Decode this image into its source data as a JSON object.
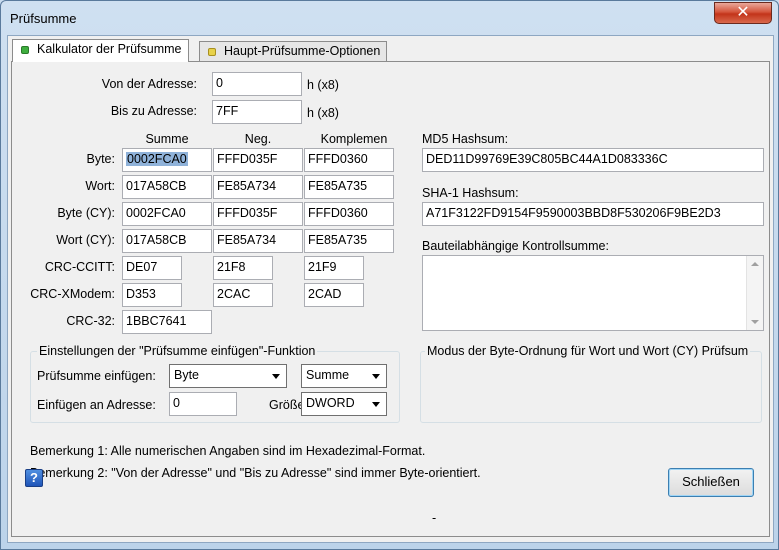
{
  "window": {
    "title": "Prüfsumme",
    "close_glyph": "✕"
  },
  "tabs": [
    {
      "label": "Kalkulator der Prüfsumme",
      "icon": "green-square-icon",
      "active": true
    },
    {
      "label": "Haupt-Prüfsumme-Optionen",
      "icon": "yellow-square-icon",
      "active": false
    }
  ],
  "range": {
    "from_label": "Von der Adresse:",
    "from_value": "0",
    "to_label": "Bis zu Adresse:",
    "to_value": "7FF",
    "unit": "h (x8)"
  },
  "checksums": {
    "columns": [
      "Summe",
      "Neg.",
      "Komplemen"
    ],
    "rows": [
      {
        "label": "Byte:",
        "values": [
          "0002FCA0",
          "FFFD035F",
          "FFFD0360"
        ]
      },
      {
        "label": "Wort:",
        "values": [
          "017A58CB",
          "FE85A734",
          "FE85A735"
        ]
      },
      {
        "label": "Byte (CY):",
        "values": [
          "0002FCA0",
          "FFFD035F",
          "FFFD0360"
        ]
      },
      {
        "label": "Wort (CY):",
        "values": [
          "017A58CB",
          "FE85A734",
          "FE85A735"
        ]
      },
      {
        "label": "CRC-CCITT:",
        "values": [
          "DE07",
          "21F8",
          "21F9"
        ]
      },
      {
        "label": "CRC-XModem:",
        "values": [
          "D353",
          "2CAC",
          "2CAD"
        ]
      },
      {
        "label": "CRC-32:",
        "values": [
          "1BBC7641"
        ]
      }
    ]
  },
  "hashes": {
    "md5_label": "MD5 Hashsum:",
    "md5_value": "DED11D99769E39C805BC44A1D083336C",
    "sha1_label": "SHA-1 Hashsum:",
    "sha1_value": "A71F3122FD9154F9590003BBD8F530206F9BE2D3",
    "device_label": "Bauteilabhängige Kontrollsumme:"
  },
  "insert_settings": {
    "legend": "Einstellungen der \"Prüfsumme einfügen\"-Funktion",
    "insert_label": "Prüfsumme einfügen:",
    "insert_type": "Byte",
    "insert_kind": "Summe",
    "address_label": "Einfügen an Adresse:",
    "address_value": "0",
    "size_label": "Größe:",
    "size_value": "DWORD"
  },
  "byte_order": {
    "legend": "Modus der Byte-Ordnung für Wort und Wort (CY) Prüfsum"
  },
  "notes": [
    "Bemerkung 1: Alle numerischen Angaben sind im Hexadezimal-Format.",
    "Bemerkung 2: \"Von der Adresse\" und \"Bis zu Adresse\" sind immer Byte-orientiert."
  ],
  "footer": {
    "help_glyph": "?",
    "center_mark": "-",
    "close_button": "Schließen"
  },
  "colors": {
    "selection": "#8fb2d9",
    "title_close": "#c3341a",
    "tab_green": "#3fae3f",
    "tab_yellow": "#e8d24a"
  }
}
